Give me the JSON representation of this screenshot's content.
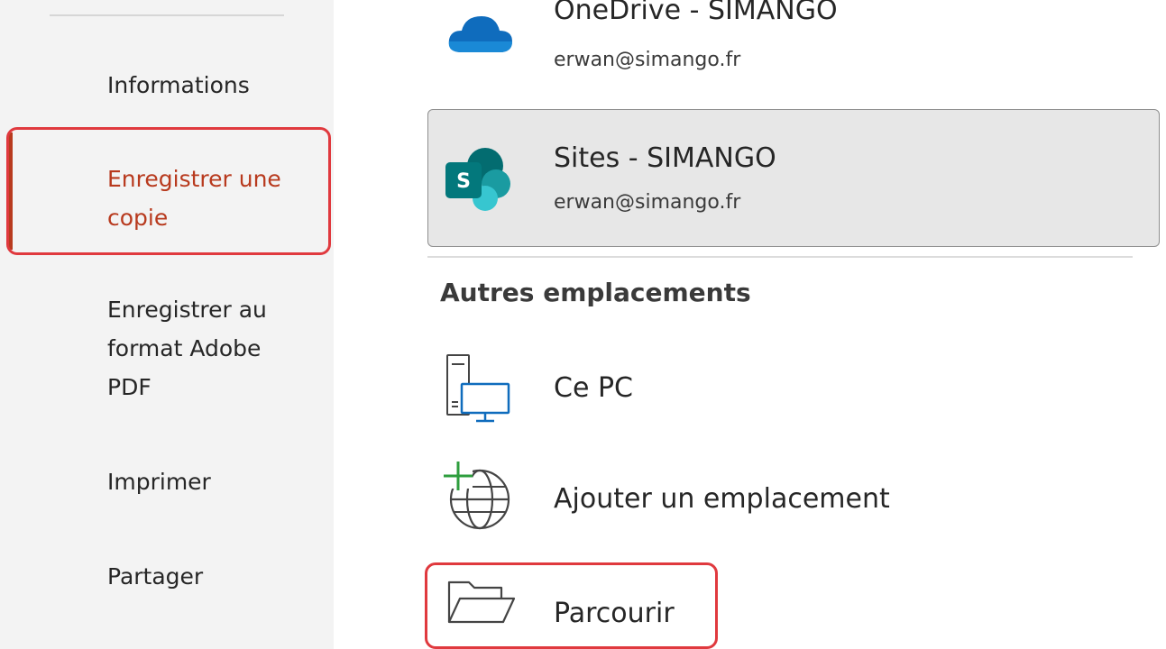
{
  "sidebar": {
    "items": [
      {
        "label": "Informations"
      },
      {
        "label_line1": "Enregistrer une",
        "label_line2": "copie"
      },
      {
        "label_line1": "Enregistrer au",
        "label_line2": "format Adobe",
        "label_line3": "PDF"
      },
      {
        "label": "Imprimer"
      },
      {
        "label": "Partager"
      }
    ]
  },
  "locations": {
    "onedrive": {
      "name": "OneDrive - SIMANGO",
      "email": "erwan@simango.fr",
      "icon": "onedrive-icon"
    },
    "sites": {
      "name": "Sites - SIMANGO",
      "email": "erwan@simango.fr",
      "icon": "sharepoint-icon",
      "icon_letter": "S"
    }
  },
  "other_locations": {
    "title": "Autres emplacements",
    "items": [
      {
        "label": "Ce PC",
        "icon": "computer-icon"
      },
      {
        "label": "Ajouter un emplacement",
        "icon": "add-globe-icon"
      },
      {
        "label": "Parcourir",
        "icon": "folder-icon"
      }
    ]
  },
  "colors": {
    "accent": "#b83a1e",
    "highlight": "#e0393e",
    "selected_bg": "#e7e7e7"
  }
}
